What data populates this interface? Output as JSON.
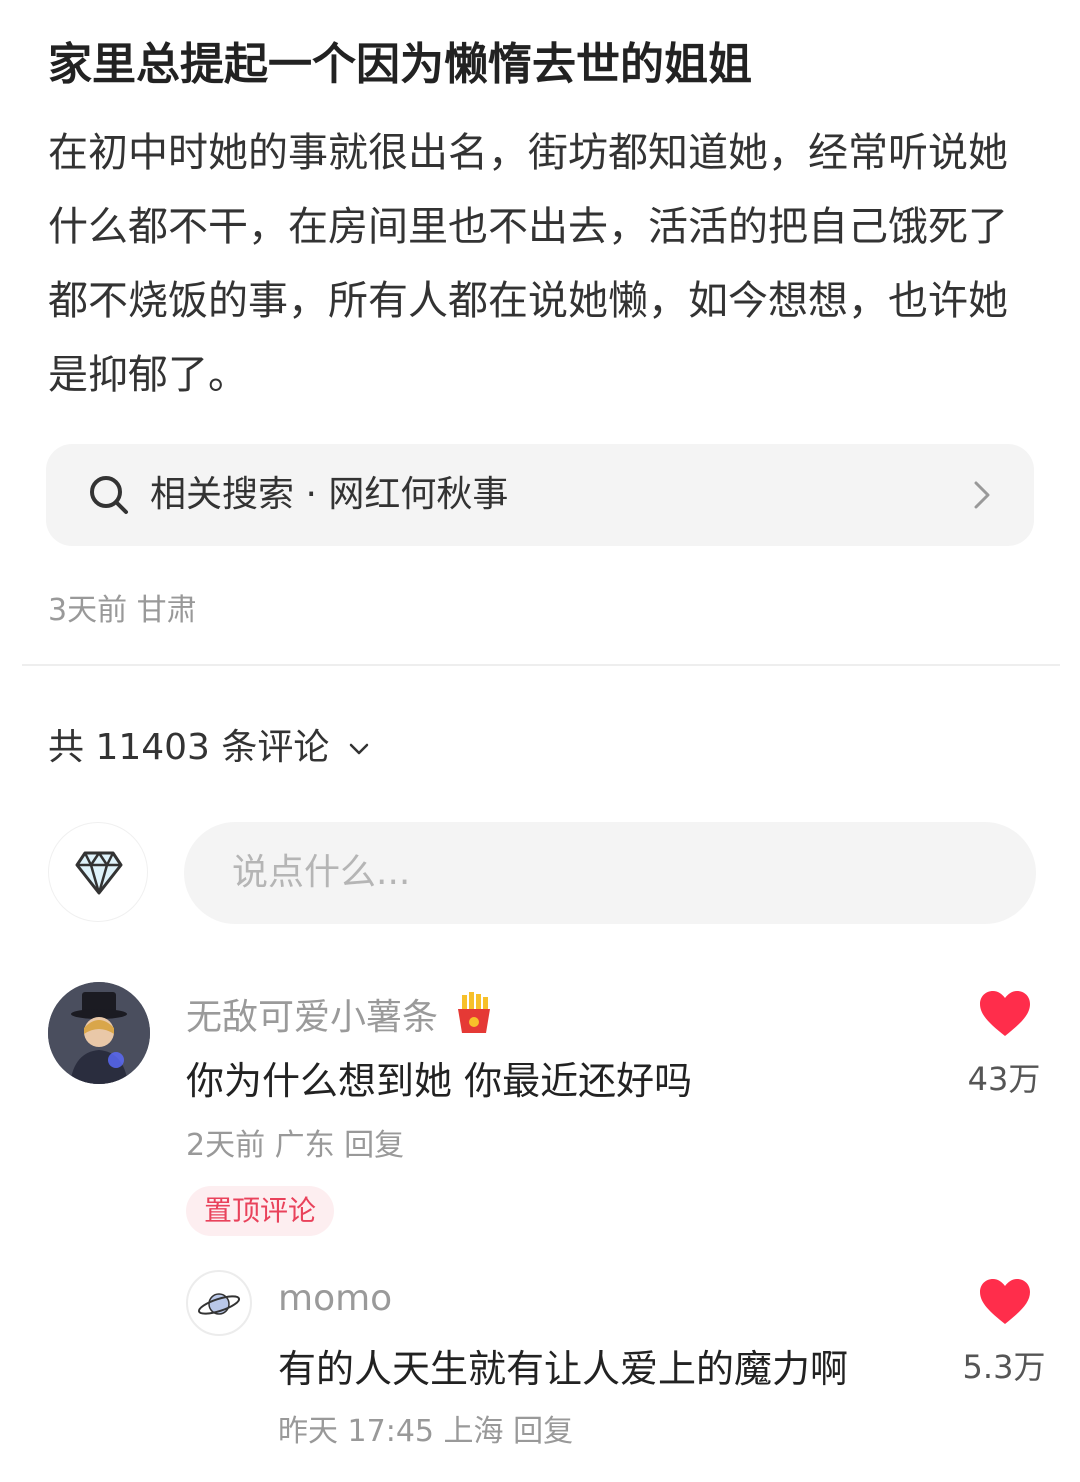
{
  "post": {
    "title": "家里总提起一个因为懒惰去世的姐姐",
    "body": "在初中时她的事就很出名，街坊都知道她，经常听说她什么都不干，在房间里也不出去，活活的把自己饿死了都不烧饭的事，所有人都在说她懒，如今想想，也许她是抑郁了。",
    "related_search": "相关搜索 · 网红何秋事",
    "meta": "3天前 甘肃"
  },
  "comments_header": {
    "count_label": "共 11403 条评论"
  },
  "comment_input": {
    "placeholder": "说点什么..."
  },
  "comments": [
    {
      "username": "无敌可爱小薯条",
      "text": "你为什么想到她 你最近还好吗",
      "meta": "2天前 广东 回复",
      "likes": "43万",
      "badge": "置顶评论",
      "name_icon": "fries-icon"
    },
    {
      "username": "momo",
      "text": "有的人天生就有让人爱上的魔力啊",
      "meta": "昨天 17:45 上海 回复",
      "likes": "5.3万",
      "avatar_icon": "planet-icon"
    }
  ],
  "colors": {
    "heart": "#ff2d4b",
    "accent_badge": "#e9425b"
  }
}
